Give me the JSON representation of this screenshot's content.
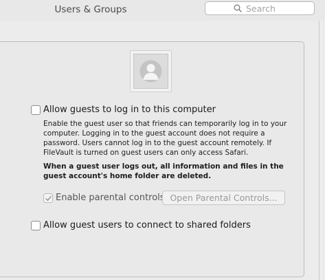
{
  "window": {
    "title": "Users & Groups"
  },
  "search": {
    "placeholder": "Search",
    "icon": "magnifying-glass"
  },
  "guest": {
    "avatar_icon": "person-silhouette",
    "allow_login": {
      "label": "Allow guests to log in to this computer",
      "checked": false
    },
    "description_lines": [
      "Enable the guest user so that friends can temporarily log in to your",
      "computer. Logging in to the guest account does not require a",
      "password. Users cannot log in to the guest account remotely. If",
      "FileVault is turned on guest users can only access Safari."
    ],
    "warning_lines": [
      "When a guest user logs out, all information and files in the",
      "guest account's home folder are deleted."
    ],
    "parental_controls": {
      "label": "Enable parental controls",
      "checked": true,
      "enabled": false
    },
    "open_parental_button": "Open Parental Controls...",
    "shared_folders": {
      "label": "Allow guest users to connect to shared folders",
      "checked": false
    }
  },
  "colors": {
    "window_bg": "#ececec",
    "panel_bg": "#e9e9e9",
    "disabled_text": "#9a9a9a"
  }
}
